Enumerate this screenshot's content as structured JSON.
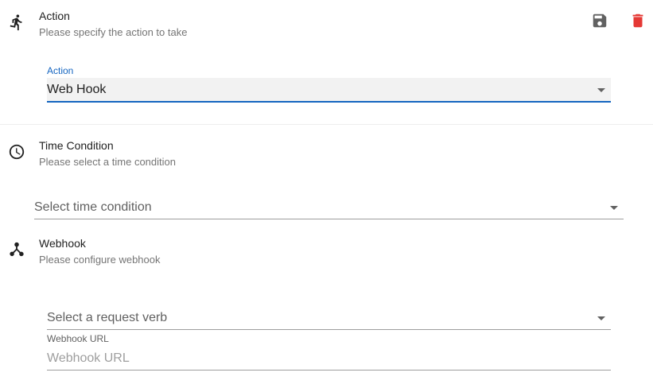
{
  "action_section": {
    "title": "Action",
    "subtitle": "Please specify the action to take",
    "icon": "run-icon",
    "save_icon": "save-icon",
    "delete_icon": "delete-icon",
    "field_label": "Action",
    "field_value": "Web Hook",
    "accent_color": "#1565c0",
    "delete_color": "#e53935"
  },
  "time_section": {
    "title": "Time Condition",
    "subtitle": "Please select a time condition",
    "icon": "clock-icon",
    "placeholder": "Select time condition"
  },
  "webhook_section": {
    "title": "Webhook",
    "subtitle": "Please configure webhook",
    "icon": "webhook-icon",
    "verb_placeholder": "Select a request verb",
    "url_label": "Webhook URL",
    "url_placeholder": "Webhook URL"
  }
}
